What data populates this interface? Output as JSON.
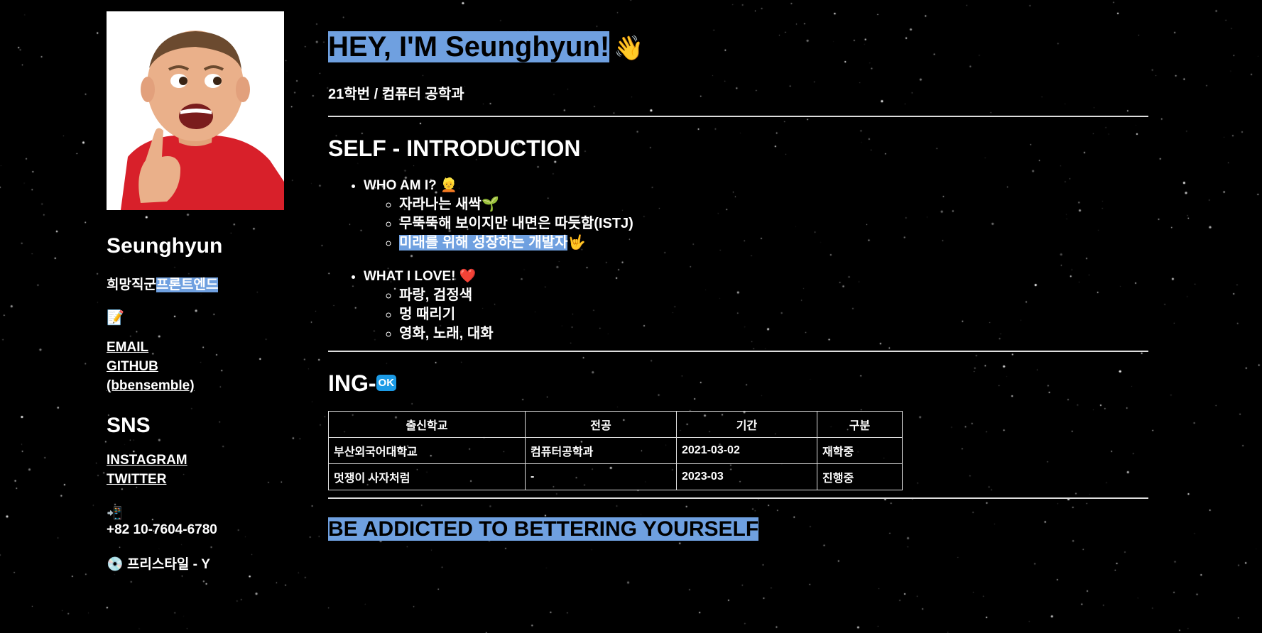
{
  "profile": {
    "name": "Seunghyun",
    "job_prefix": "희망직군",
    "job_value": "프론트엔드",
    "memo_icon": "memo-icon",
    "links": [
      {
        "label": "EMAIL"
      },
      {
        "label": "GITHUB"
      },
      {
        "label": "(bbensemble)"
      }
    ],
    "sns_title": "SNS",
    "sns_links": [
      {
        "label": "INSTAGRAM"
      },
      {
        "label": "TWITTER"
      }
    ],
    "phone_icon": "mobile-phone-icon",
    "phone": "+82 10-7604-6780",
    "music_icon": "cd-icon",
    "music": "프리스타일 - Y"
  },
  "header": {
    "title": "HEY, I'M Seunghyun!",
    "wave": "👋",
    "subtitle": "21학번 / 컴퓨터 공학과"
  },
  "intro": {
    "title": "SELF - INTRODUCTION",
    "sections": [
      {
        "heading": "WHO AM I?",
        "icon": "👱",
        "items": [
          {
            "text": "자라나는 새싹",
            "icon": "🌱"
          },
          {
            "text": "무뚝뚝해 보이지만 내면은 따듯함(ISTJ)",
            "icon": ""
          },
          {
            "text": "미래를 위해 성장하는 개발자",
            "icon": "🤟"
          }
        ]
      },
      {
        "heading": "WHAT I LOVE!",
        "icon": "❤️",
        "items": [
          {
            "text": "파랑, 검정색"
          },
          {
            "text": "멍 때리기"
          },
          {
            "text": "영화, 노래, 대화"
          }
        ]
      }
    ]
  },
  "ing": {
    "title": "ING-",
    "badge": "OK",
    "columns": [
      "출신학교",
      "전공",
      "기간",
      "구분"
    ],
    "rows": [
      [
        "부산외국어대학교",
        "컴퓨터공학과",
        "2021-03-02",
        "재학중"
      ],
      [
        "멋쟁이 사자처럼",
        "-",
        "2023-03",
        "진행중"
      ]
    ]
  },
  "footer": {
    "motto": "BE ADDICTED TO BETTERING YOURSELF"
  },
  "colors": {
    "highlight": "#6fa0e0",
    "background": "#000000",
    "badge": "#1c9be6"
  }
}
